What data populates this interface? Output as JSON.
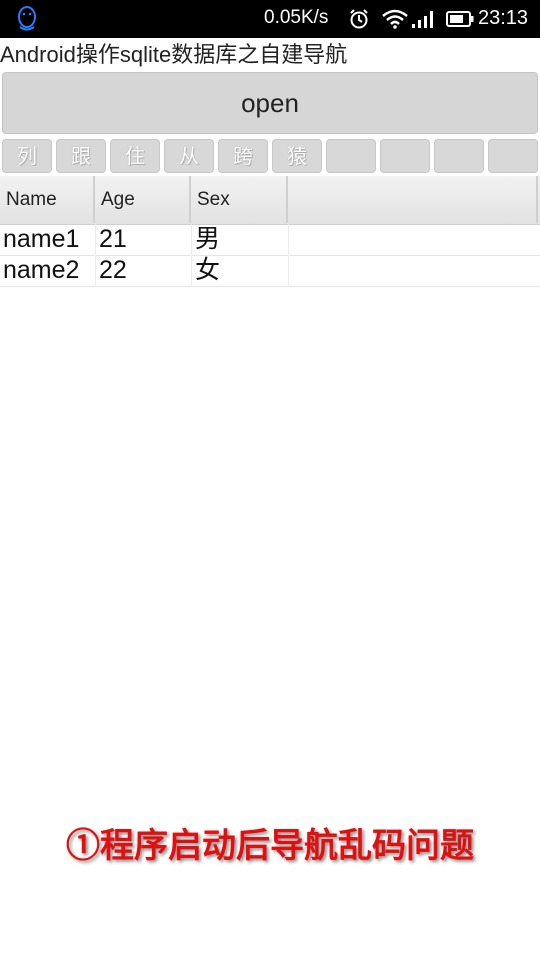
{
  "status_bar": {
    "network_speed": "0.05K/s",
    "time": "23:13",
    "icons": [
      "qq-penguin-icon",
      "alarm-clock-icon",
      "wifi-icon",
      "signal-icon",
      "battery-icon"
    ]
  },
  "app": {
    "title": "Android操作sqlite数据库之自建导航",
    "open_button_label": "open",
    "nav_buttons": [
      "列",
      "跟",
      "住",
      "从",
      "跨",
      "猿",
      "",
      "",
      "",
      ""
    ]
  },
  "table": {
    "headers": [
      "Name",
      "Age",
      "Sex",
      ""
    ],
    "rows": [
      [
        "name1",
        "21",
        "男",
        ""
      ],
      [
        "name2",
        "22",
        "女",
        ""
      ]
    ]
  },
  "caption": "①程序启动后导航乱码问题",
  "colors": {
    "status_bar_bg": "#000000",
    "caption": "#e01010",
    "button_bg": "#d6d6d6"
  }
}
